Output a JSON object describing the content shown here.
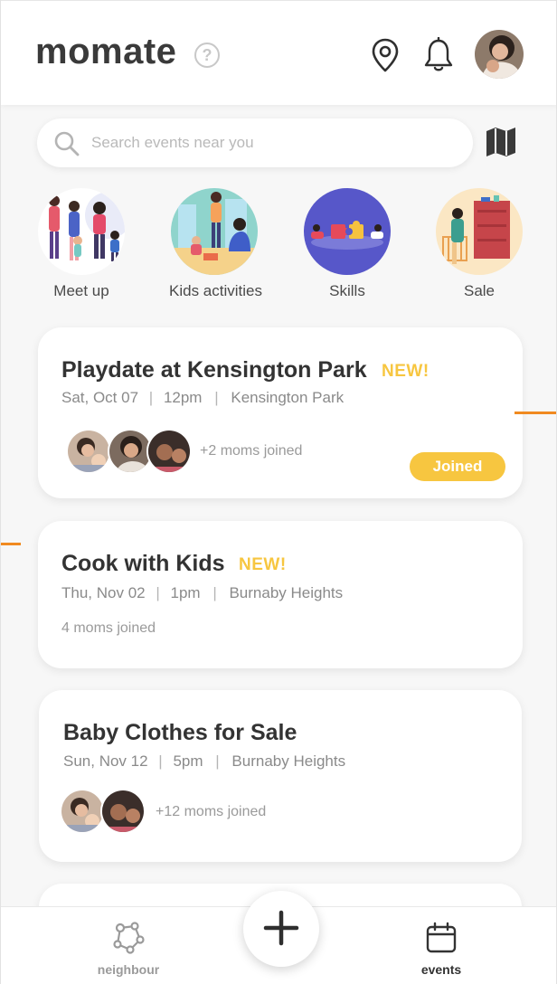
{
  "app": {
    "brand": "momate",
    "help_symbol": "?",
    "header_icons": [
      "help-icon",
      "location-pin-icon",
      "bell-icon",
      "avatar"
    ]
  },
  "search": {
    "placeholder": "Search events near you",
    "icons": [
      "search-icon",
      "map-icon"
    ]
  },
  "categories": [
    {
      "label": "Meet up"
    },
    {
      "label": "Kids activities"
    },
    {
      "label": "Skills"
    },
    {
      "label": "Sale"
    }
  ],
  "events": [
    {
      "title": "Playdate at Kensington Park",
      "badge": "NEW!",
      "date": "Sat, Oct 07",
      "time": "12pm",
      "place": "Kensington Park",
      "joined": "+2 moms joined",
      "status": "Joined"
    },
    {
      "title": "Cook with Kids",
      "badge": "NEW!",
      "date": "Thu, Nov 02",
      "time": "1pm",
      "place": "Burnaby Heights",
      "joined": "4 moms joined"
    },
    {
      "title": "Baby Clothes for Sale",
      "date": "Sun, Nov 12",
      "time": "5pm",
      "place": "Burnaby Heights",
      "joined": "+12 moms joined"
    }
  ],
  "separator": "|",
  "nav": {
    "left": {
      "label": "neighbour",
      "icon": "neighbour-icon"
    },
    "center": {
      "icon": "plus-icon"
    },
    "right": {
      "label": "events",
      "icon": "calendar-icon"
    }
  },
  "colors": {
    "accent": "#f7c640",
    "annotation_line": "#f08a20",
    "text_dark": "#333333",
    "text_muted": "#8a8a8a"
  }
}
